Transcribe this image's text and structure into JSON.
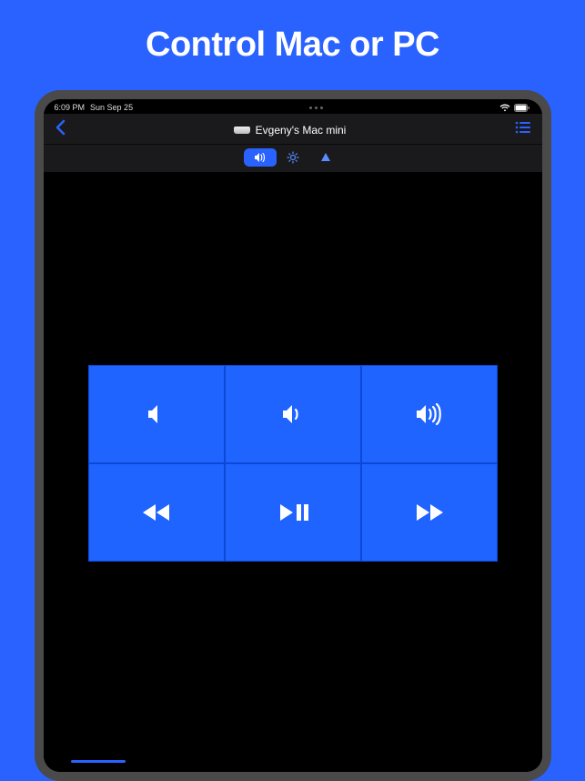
{
  "headline": "Control Mac or PC",
  "status": {
    "time": "6:09 PM",
    "date": "Sun Sep 25"
  },
  "nav": {
    "title": "Evgeny's Mac mini"
  },
  "tabs": [
    {
      "name": "volume",
      "active": true
    },
    {
      "name": "brightness",
      "active": false
    },
    {
      "name": "cursor",
      "active": false
    }
  ],
  "controls": [
    {
      "name": "volume-mute"
    },
    {
      "name": "volume-down"
    },
    {
      "name": "volume-up"
    },
    {
      "name": "rewind"
    },
    {
      "name": "play-pause"
    },
    {
      "name": "forward"
    }
  ],
  "colors": {
    "accent": "#2962ff",
    "button": "#2064ff"
  }
}
